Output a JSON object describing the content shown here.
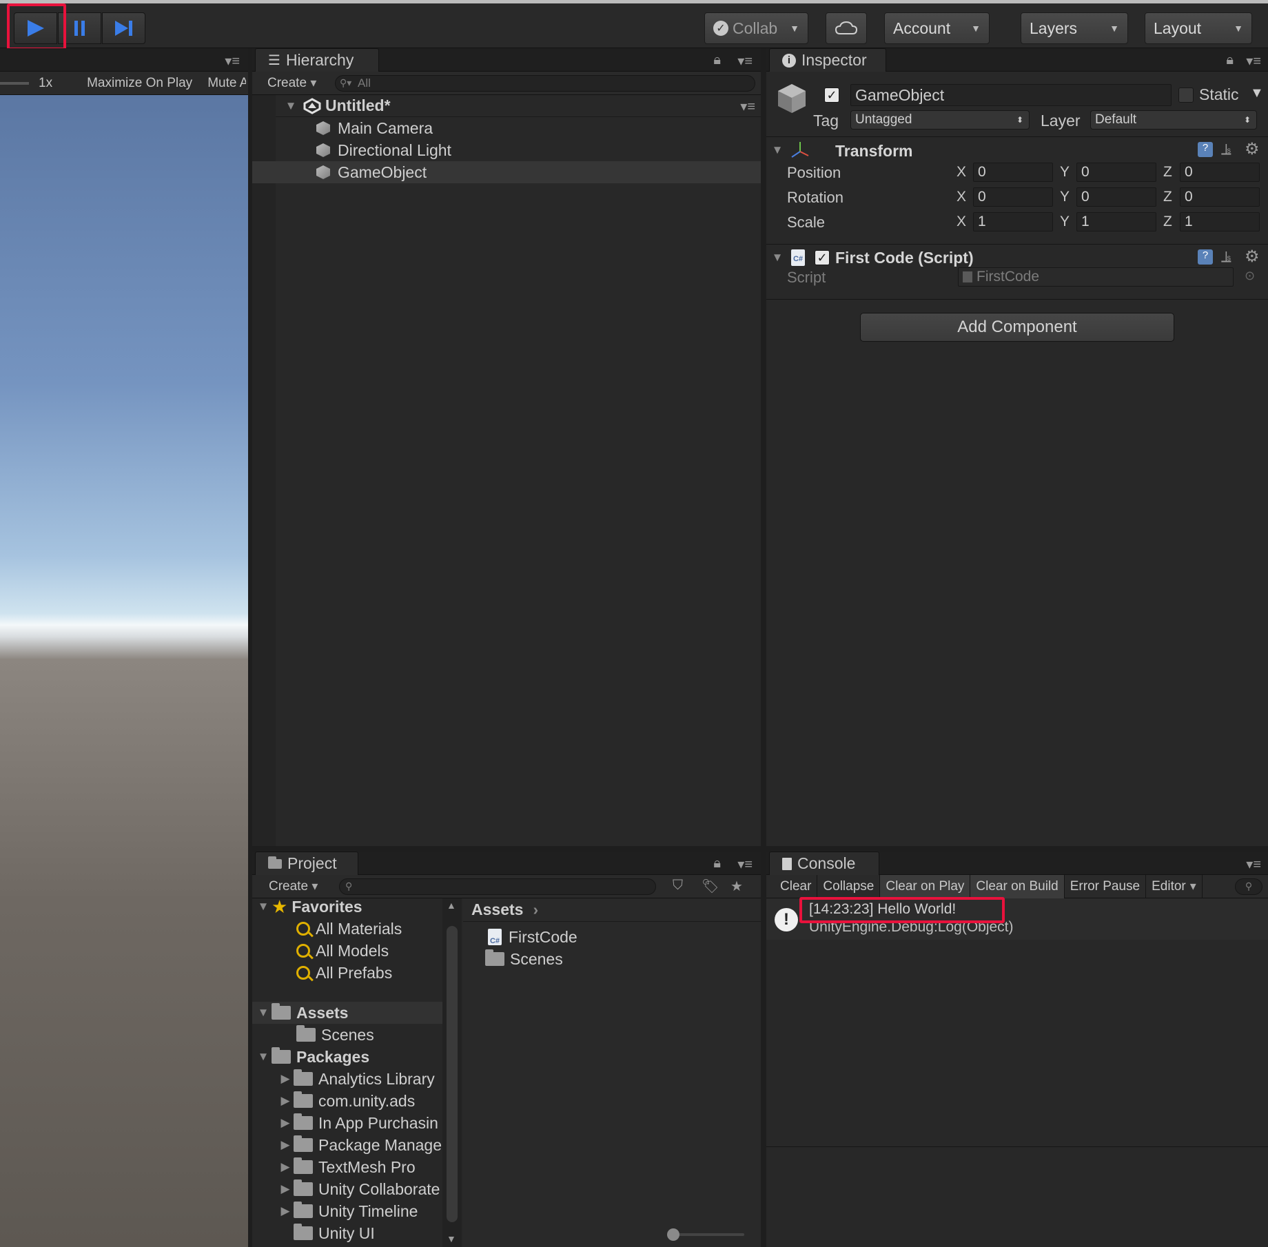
{
  "toolbar": {
    "collab_label": "Collab",
    "account_label": "Account",
    "layers_label": "Layers",
    "layout_label": "Layout"
  },
  "game_view": {
    "scale_label": "1x",
    "maximize_label": "Maximize On Play",
    "mute_label": "Mute A"
  },
  "hierarchy": {
    "tab_label": "Hierarchy",
    "create_label": "Create",
    "search_placeholder": "All",
    "scene_name": "Untitled*",
    "items": [
      {
        "label": "Main Camera"
      },
      {
        "label": "Directional Light"
      },
      {
        "label": "GameObject"
      }
    ]
  },
  "inspector": {
    "tab_label": "Inspector",
    "object_name": "GameObject",
    "static_label": "Static",
    "tag_label": "Tag",
    "tag_value": "Untagged",
    "layer_label": "Layer",
    "layer_value": "Default",
    "transform": {
      "title": "Transform",
      "rows": [
        {
          "label": "Position",
          "x": "0",
          "y": "0",
          "z": "0"
        },
        {
          "label": "Rotation",
          "x": "0",
          "y": "0",
          "z": "0"
        },
        {
          "label": "Scale",
          "x": "1",
          "y": "1",
          "z": "1"
        }
      ],
      "axis_x": "X",
      "axis_y": "Y",
      "axis_z": "Z"
    },
    "script_component": {
      "title": "First Code (Script)",
      "script_label": "Script",
      "script_value": "FirstCode"
    },
    "add_component_label": "Add Component"
  },
  "project": {
    "tab_label": "Project",
    "create_label": "Create",
    "favorites_label": "Favorites",
    "favorites": [
      "All Materials",
      "All Models",
      "All Prefabs"
    ],
    "assets_label": "Assets",
    "assets_children": [
      "Scenes"
    ],
    "packages_label": "Packages",
    "packages": [
      "Analytics Library",
      "com.unity.ads",
      "In App Purchasin",
      "Package Manage",
      "TextMesh Pro",
      "Unity Collaborate",
      "Unity Timeline",
      "Unity UI"
    ],
    "breadcrumb": "Assets",
    "files": [
      {
        "label": "FirstCode",
        "icon": "cs-script-icon"
      },
      {
        "label": "Scenes",
        "icon": "folder-icon"
      }
    ]
  },
  "console": {
    "tab_label": "Console",
    "buttons": [
      "Clear",
      "Collapse",
      "Clear on Play",
      "Clear on Build",
      "Error Pause",
      "Editor"
    ],
    "message_line1": "[14:23:23] Hello World!",
    "message_line2": "UnityEngine.Debug:Log(Object)"
  },
  "colors": {
    "highlight": "#e8123c",
    "play_blue": "#3a7de8"
  }
}
